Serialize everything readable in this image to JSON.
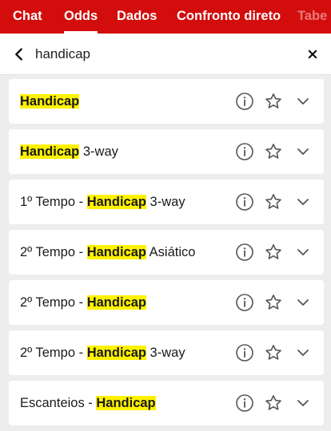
{
  "tabs": [
    {
      "label": "Chat",
      "active": false
    },
    {
      "label": "Odds",
      "active": true
    },
    {
      "label": "Dados",
      "active": false
    },
    {
      "label": "Confronto direto",
      "active": false
    },
    {
      "label": "Tabe",
      "active": false
    }
  ],
  "search": {
    "value": "handicap",
    "back_icon": "chevron-left-icon",
    "clear_icon": "close-icon"
  },
  "colors": {
    "brand": "#d30c0c",
    "highlight": "#fff200",
    "background": "#ededed",
    "row": "#ffffff"
  },
  "icons": {
    "info": "info-circle-icon",
    "favorite": "star-outline-icon",
    "expand": "chevron-down-icon"
  },
  "markets": [
    {
      "pre": "",
      "match": "Handicap",
      "post": ""
    },
    {
      "pre": "",
      "match": "Handicap",
      "post": " 3-way"
    },
    {
      "pre": "1º Tempo - ",
      "match": "Handicap",
      "post": " 3-way"
    },
    {
      "pre": "2º Tempo - ",
      "match": "Handicap",
      "post": " Asiático"
    },
    {
      "pre": "2º Tempo - ",
      "match": "Handicap",
      "post": ""
    },
    {
      "pre": "2º Tempo - ",
      "match": "Handicap",
      "post": " 3-way"
    },
    {
      "pre": "Escanteios - ",
      "match": "Handicap",
      "post": ""
    }
  ]
}
